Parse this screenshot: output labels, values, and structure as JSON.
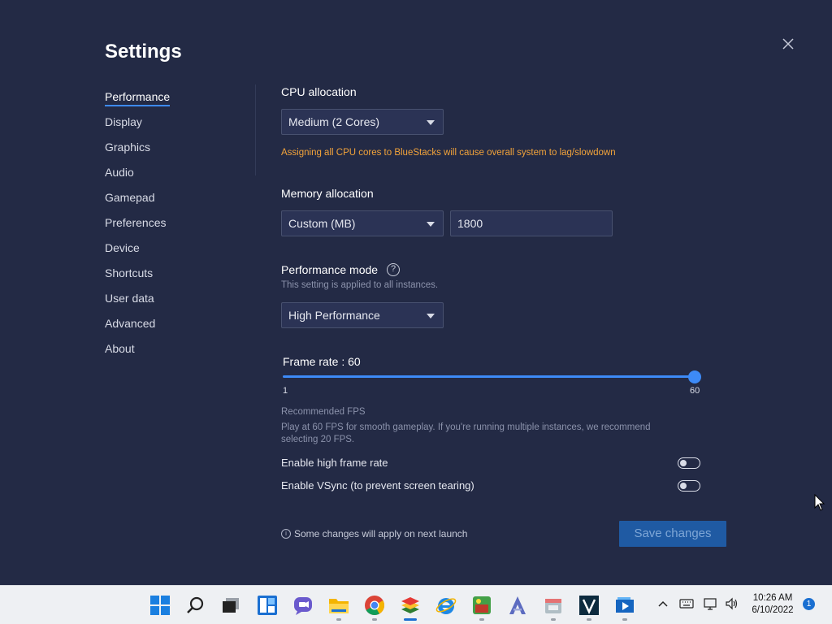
{
  "title": "Settings",
  "nav": [
    {
      "label": "Performance",
      "active": true
    },
    {
      "label": "Display"
    },
    {
      "label": "Graphics"
    },
    {
      "label": "Audio"
    },
    {
      "label": "Gamepad"
    },
    {
      "label": "Preferences"
    },
    {
      "label": "Device"
    },
    {
      "label": "Shortcuts"
    },
    {
      "label": "User data"
    },
    {
      "label": "Advanced"
    },
    {
      "label": "About"
    }
  ],
  "cpu": {
    "label": "CPU allocation",
    "value": "Medium (2 Cores)",
    "warning": "Assigning all CPU cores to BlueStacks will cause overall system to lag/slowdown"
  },
  "memory": {
    "label": "Memory allocation",
    "mode": "Custom (MB)",
    "value": "1800"
  },
  "performance_mode": {
    "label": "Performance mode",
    "help_glyph": "?",
    "note": "This setting is applied to all instances.",
    "value": "High Performance"
  },
  "frame_rate": {
    "label": "Frame rate : 60",
    "value": 60,
    "min_label": "1",
    "max_label": "60",
    "recommended_title": "Recommended FPS",
    "recommended_text_1": "Play at 60 FPS for smooth gameplay. If you're running multiple instances, we recommend",
    "recommended_text_2": "selecting 20 FPS."
  },
  "toggles": {
    "high_frame_rate": {
      "label": "Enable high frame rate",
      "on": false
    },
    "vsync": {
      "label": "Enable VSync (to prevent screen tearing)",
      "on": false
    }
  },
  "footer": {
    "info_glyph": "i",
    "note": "Some changes will apply on next launch",
    "save_label": "Save changes"
  },
  "taskbar": {
    "time": "10:26 AM",
    "date": "6/10/2022",
    "notification_count": "1",
    "apps": [
      "start-icon",
      "search-icon",
      "task-view-icon",
      "widgets-icon",
      "chat-icon",
      "file-explorer-icon",
      "chrome-icon",
      "bluestacks-icon",
      "internet-explorer-icon",
      "game-icon",
      "app-a-icon",
      "app-box-icon",
      "v-app-icon",
      "media-player-icon"
    ]
  },
  "colors": {
    "background": "#232a45",
    "accent": "#3d8af7",
    "warning": "#f2a33a",
    "save_button": "#1f5aa3"
  }
}
